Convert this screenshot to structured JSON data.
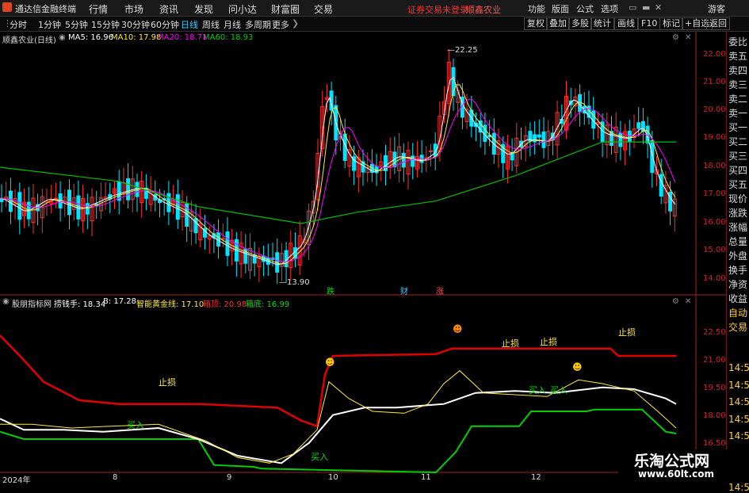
{
  "menubar": {
    "app_title": "通达信金融终端",
    "items": [
      "行情",
      "市场",
      "资讯",
      "发现",
      "问小达",
      "财富圈",
      "交易"
    ],
    "notice": "证券交易未登录",
    "stock": "顺鑫农业",
    "right_items": [
      "功能",
      "版面",
      "公式",
      "选项"
    ],
    "guest": "游客"
  },
  "toolbar": {
    "periods": [
      "分时",
      "1分钟",
      "5分钟",
      "15分钟",
      "30分钟",
      "60分钟",
      "日线",
      "周线",
      "月线",
      "多周期",
      "更多"
    ],
    "active_period": "日线",
    "right_buttons": [
      "复权",
      "叠加",
      "多股",
      "统计",
      "画线",
      "F10",
      "标记",
      "+自选",
      "返回"
    ]
  },
  "price_panel": {
    "title": "顺鑫农业(日线)",
    "ma5": "MA5: 16.96",
    "ma10": "MA10: 17.98",
    "ma20": "MA20: 18.71",
    "ma60": "MA60: 18.93",
    "high_label": "22.25",
    "low_label": "13.90",
    "event_markers": [
      "跌",
      "财",
      "涨"
    ],
    "y_ticks": [
      "22.00",
      "21.00",
      "20.00",
      "19.00",
      "18.00",
      "17.00",
      "16.00",
      "15.00",
      "14.00"
    ]
  },
  "indicator_panel": {
    "name": "股朋指标网",
    "l1": "捞钱手: 18.34",
    "l2": "B: 17.28",
    "l3": "智能黄金线: 17.10",
    "l4": "箱顶: 20.98",
    "l5": "箱底: 16.99",
    "y_ticks": [
      "22.50",
      "21.00",
      "19.50",
      "18.00",
      "16.50"
    ],
    "notes": {
      "stop1": "止损",
      "stop2": "止损",
      "stop3": "止损",
      "stop4": "止损",
      "buy1": "买入",
      "buy2": "买入",
      "buy3": "买入",
      "buy4": "买入"
    }
  },
  "x_axis": [
    "2024年",
    "8",
    "9",
    "10",
    "11",
    "12"
  ],
  "side_panel": [
    "委比",
    "卖五",
    "卖四",
    "卖三",
    "卖二",
    "卖一",
    "买一",
    "买二",
    "买三",
    "买四",
    "买五",
    "现价",
    "涨跌",
    "涨幅",
    "总量",
    "外盘",
    "换手",
    "净资",
    "收益",
    "自动",
    "交易",
    "14:56",
    "14:56",
    "14:56",
    "14:56",
    "14:56",
    "14:56",
    "14:56",
    "14:56"
  ],
  "watermark": {
    "line1": "乐淘公式网",
    "line2": "www.60lt.com"
  },
  "colors": {
    "up": "#ff3030",
    "down": "#00e5ff",
    "ma5": "#ffffff",
    "ma10": "#ffeb3b",
    "ma20": "#ff00ff",
    "ma60": "#00c000",
    "box_top": "#e00000",
    "box_bottom": "#00d000"
  }
}
